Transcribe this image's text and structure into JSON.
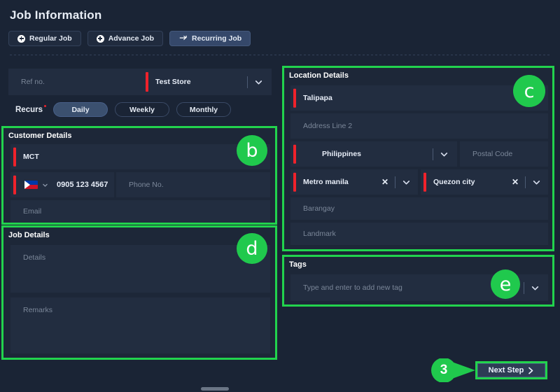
{
  "header": {
    "title": "Job Information",
    "job_types": [
      {
        "label": "Regular Job",
        "icon": "plus-circle-icon",
        "active": false
      },
      {
        "label": "Advance Job",
        "icon": "plus-circle-icon",
        "active": false
      },
      {
        "label": "Recurring Job",
        "icon": "recurring-icon",
        "active": true
      }
    ]
  },
  "ref_row": {
    "ref_placeholder": "Ref no.",
    "ref_value": "",
    "store_value": "Test Store",
    "store_chevron": "chevron-down-icon"
  },
  "recurs": {
    "label": "Recurs",
    "required": true,
    "options": [
      {
        "label": "Daily",
        "selected": true
      },
      {
        "label": "Weekly",
        "selected": false
      },
      {
        "label": "Monthly",
        "selected": false
      }
    ]
  },
  "customer_details": {
    "heading": "Customer Details",
    "badge": "b",
    "name_value": "MCT",
    "country_code_flag": "philippines-flag-icon",
    "phone_value": "0905 123 4567",
    "phone_alt_placeholder": "Phone No.",
    "phone_alt_value": "",
    "email_placeholder": "Email",
    "email_value": ""
  },
  "job_details": {
    "heading": "Job Details",
    "badge": "d",
    "details_placeholder": "Details",
    "details_value": "",
    "remarks_placeholder": "Remarks",
    "remarks_value": ""
  },
  "location_details": {
    "heading": "Location Details",
    "badge": "c",
    "address_line_1_value": "Talipapa",
    "address_line_2_placeholder": "Address Line 2",
    "address_line_2_value": "",
    "country_value": "Philippines",
    "country_flag": "philippines-flag-icon",
    "postal_code_placeholder": "Postal Code",
    "postal_code_value": "",
    "province_value": "Metro manila",
    "city_value": "Quezon city",
    "clear_icon": "close-x-icon",
    "barangay_placeholder": "Barangay",
    "barangay_value": "",
    "landmark_placeholder": "Landmark",
    "landmark_value": ""
  },
  "tags": {
    "heading": "Tags",
    "badge": "e",
    "placeholder": "Type and enter to add new tag",
    "value": "",
    "chevron": "chevron-down-icon"
  },
  "footer": {
    "step_number": "3",
    "next_label": "Next Step",
    "next_icon": "chevron-right-icon"
  },
  "colors": {
    "highlight_green": "#22d34d",
    "badge_green": "#20c94d",
    "required_red": "#f0222b",
    "page_bg": "#1a2435",
    "field_bg": "#222d40",
    "accent_blue": "#35486a"
  }
}
